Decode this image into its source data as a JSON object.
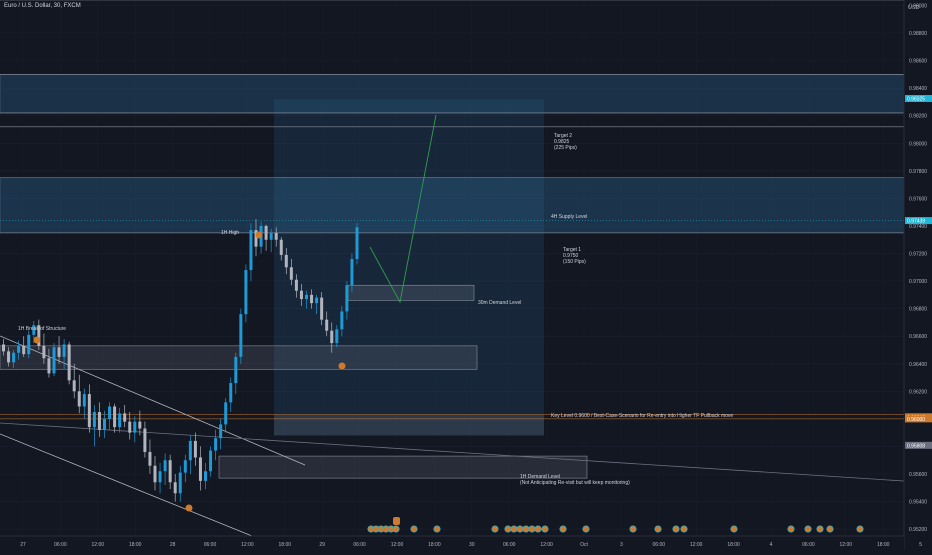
{
  "header": {
    "title": "Euro / U.S. Dollar, 30, FXCM",
    "currency": "USD"
  },
  "chart_data": {
    "type": "candlestick",
    "ylim": [
      0.9515,
      0.9904
    ],
    "y_ticks": [
      "0.99000",
      "0.98800",
      "0.98600",
      "0.98400",
      "0.98200",
      "0.98000",
      "0.97800",
      "0.97600",
      "0.97400",
      "0.97200",
      "0.97000",
      "0.96800",
      "0.96600",
      "0.96400",
      "0.96200",
      "0.96000",
      "0.95800",
      "0.95600",
      "0.95400",
      "0.95200"
    ],
    "x_ticks": [
      "27",
      "06:00",
      "12:00",
      "18:00",
      "28",
      "06:00",
      "12:00",
      "18:00",
      "29",
      "06:00",
      "12:00",
      "18:00",
      "30",
      "06:00",
      "12:00",
      "Oct",
      "3",
      "06:00",
      "12:00",
      "18:00",
      "4",
      "06:00",
      "12:00",
      "18:00",
      "5"
    ],
    "price_labels": [
      {
        "text": "0.98325",
        "value": 0.98325,
        "color": "#1fb6d7"
      },
      {
        "text": "0.97439",
        "value": 0.97439,
        "color": "#1fb6d7"
      },
      {
        "text": "0.96015",
        "value": 0.96015,
        "color": "#cc7a2e"
      },
      {
        "text": "0.96000",
        "value": 0.96,
        "color": "#cc7a2e"
      },
      {
        "text": "0.95808",
        "value": 0.95808,
        "color": "#6b7080"
      }
    ],
    "zones": [
      {
        "name": "zone-upper-supply",
        "y1": 0.9822,
        "y2": 0.985
      },
      {
        "name": "zone-4h-supply",
        "y1": 0.9735,
        "y2": 0.9775
      },
      {
        "name": "zone-target-box",
        "y1": 0.9588,
        "y2": 0.9832
      },
      {
        "name": "zone-30m-demand",
        "y1": 0.9686,
        "y2": 0.9697
      },
      {
        "name": "zone-mid-demand",
        "y1": 0.9636,
        "y2": 0.9653
      },
      {
        "name": "zone-key-level",
        "y1": 0.9588,
        "y2": 0.9603
      },
      {
        "name": "zone-1h-demand",
        "y1": 0.9557,
        "y2": 0.9573
      }
    ],
    "levels": [
      0.9904,
      0.985,
      0.9822,
      0.9812,
      0.9775,
      0.9735,
      0.9603,
      0.96
    ],
    "annotations": {
      "high_1h": "1H High",
      "break_structure": "1H Break of Structure",
      "target2": [
        "Target 2",
        "0.9825",
        "(225 Pips)"
      ],
      "supply_4h": "4H Supply Level",
      "target1": [
        "Target 1",
        "0.9750",
        "(150 Pips)"
      ],
      "demand_30m": "30m Demand Level",
      "key_level": "Key Level 0.9600 / Best-Case-Scenario for Re-entry into Higher TF Pullback move",
      "demand_1h": [
        "1H Demand Level",
        "(Not Anticipating Re-visit but will keep monitoring)"
      ]
    },
    "candles": [
      [
        0.9654,
        0.9658,
        0.9646,
        0.9649
      ],
      [
        0.9649,
        0.9652,
        0.9638,
        0.9641
      ],
      [
        0.9641,
        0.965,
        0.9637,
        0.9648
      ],
      [
        0.9648,
        0.9657,
        0.9643,
        0.9653
      ],
      [
        0.9653,
        0.966,
        0.9645,
        0.9647
      ],
      [
        0.9647,
        0.9664,
        0.9644,
        0.9661
      ],
      [
        0.9661,
        0.9671,
        0.9655,
        0.9668
      ],
      [
        0.9668,
        0.9672,
        0.965,
        0.9653
      ],
      [
        0.9653,
        0.9662,
        0.964,
        0.9644
      ],
      [
        0.9644,
        0.9651,
        0.963,
        0.9633
      ],
      [
        0.9633,
        0.9655,
        0.9631,
        0.9652
      ],
      [
        0.9652,
        0.966,
        0.964,
        0.9645
      ],
      [
        0.9645,
        0.9658,
        0.9636,
        0.9654
      ],
      [
        0.9654,
        0.9656,
        0.9625,
        0.9628
      ],
      [
        0.9628,
        0.964,
        0.9615,
        0.962
      ],
      [
        0.962,
        0.9632,
        0.9604,
        0.9609
      ],
      [
        0.9609,
        0.9622,
        0.96,
        0.9618
      ],
      [
        0.9618,
        0.9625,
        0.959,
        0.9594
      ],
      [
        0.9594,
        0.961,
        0.958,
        0.9605
      ],
      [
        0.9605,
        0.9612,
        0.9587,
        0.9592
      ],
      [
        0.9592,
        0.9606,
        0.9586,
        0.96
      ],
      [
        0.96,
        0.9612,
        0.9592,
        0.9609
      ],
      [
        0.9609,
        0.9611,
        0.959,
        0.9594
      ],
      [
        0.9594,
        0.9608,
        0.959,
        0.9604
      ],
      [
        0.9604,
        0.961,
        0.9594,
        0.9598
      ],
      [
        0.9598,
        0.9605,
        0.9585,
        0.959
      ],
      [
        0.959,
        0.9602,
        0.9583,
        0.9598
      ],
      [
        0.9598,
        0.9606,
        0.9588,
        0.9593
      ],
      [
        0.9593,
        0.9598,
        0.9572,
        0.9576
      ],
      [
        0.9576,
        0.9585,
        0.956,
        0.9566
      ],
      [
        0.9566,
        0.9573,
        0.9548,
        0.9554
      ],
      [
        0.9554,
        0.9568,
        0.9546,
        0.9562
      ],
      [
        0.9562,
        0.9575,
        0.9552,
        0.957
      ],
      [
        0.957,
        0.9574,
        0.9549,
        0.9554
      ],
      [
        0.9554,
        0.956,
        0.954,
        0.9546
      ],
      [
        0.9546,
        0.9566,
        0.954,
        0.9561
      ],
      [
        0.9561,
        0.9574,
        0.9554,
        0.957
      ],
      [
        0.957,
        0.9588,
        0.956,
        0.9584
      ],
      [
        0.9584,
        0.959,
        0.9566,
        0.9572
      ],
      [
        0.9572,
        0.958,
        0.9548,
        0.9555
      ],
      [
        0.9555,
        0.9568,
        0.9549,
        0.9562
      ],
      [
        0.9562,
        0.958,
        0.9558,
        0.9577
      ],
      [
        0.9577,
        0.9592,
        0.957,
        0.9586
      ],
      [
        0.9586,
        0.96,
        0.9578,
        0.9596
      ],
      [
        0.9596,
        0.9615,
        0.959,
        0.9612
      ],
      [
        0.9612,
        0.963,
        0.9605,
        0.9626
      ],
      [
        0.9626,
        0.9648,
        0.9618,
        0.9645
      ],
      [
        0.9645,
        0.968,
        0.964,
        0.9676
      ],
      [
        0.9676,
        0.9712,
        0.967,
        0.9708
      ],
      [
        0.9708,
        0.9742,
        0.97,
        0.9737
      ],
      [
        0.9737,
        0.9745,
        0.9718,
        0.9725
      ],
      [
        0.9725,
        0.9743,
        0.972,
        0.974
      ],
      [
        0.974,
        0.9741,
        0.9722,
        0.973
      ],
      [
        0.973,
        0.9738,
        0.9721,
        0.9735
      ],
      [
        0.9735,
        0.9739,
        0.9725,
        0.973
      ],
      [
        0.973,
        0.9732,
        0.9715,
        0.9719
      ],
      [
        0.9719,
        0.9724,
        0.9705,
        0.971
      ],
      [
        0.971,
        0.9716,
        0.9697,
        0.9701
      ],
      [
        0.9701,
        0.9705,
        0.9688,
        0.9693
      ],
      [
        0.9693,
        0.9698,
        0.9682,
        0.9687
      ],
      [
        0.9687,
        0.9693,
        0.968,
        0.969
      ],
      [
        0.969,
        0.9694,
        0.968,
        0.9684
      ],
      [
        0.9684,
        0.969,
        0.9676,
        0.9688
      ],
      [
        0.9688,
        0.9692,
        0.9668,
        0.9672
      ],
      [
        0.9672,
        0.9678,
        0.966,
        0.9664
      ],
      [
        0.9664,
        0.967,
        0.9648,
        0.9655
      ],
      [
        0.9655,
        0.9668,
        0.9652,
        0.9665
      ],
      [
        0.9665,
        0.9682,
        0.966,
        0.9678
      ],
      [
        0.9678,
        0.97,
        0.9672,
        0.9697
      ],
      [
        0.9697,
        0.972,
        0.9692,
        0.9716
      ],
      [
        0.9716,
        0.9742,
        0.9712,
        0.9739
      ]
    ]
  }
}
